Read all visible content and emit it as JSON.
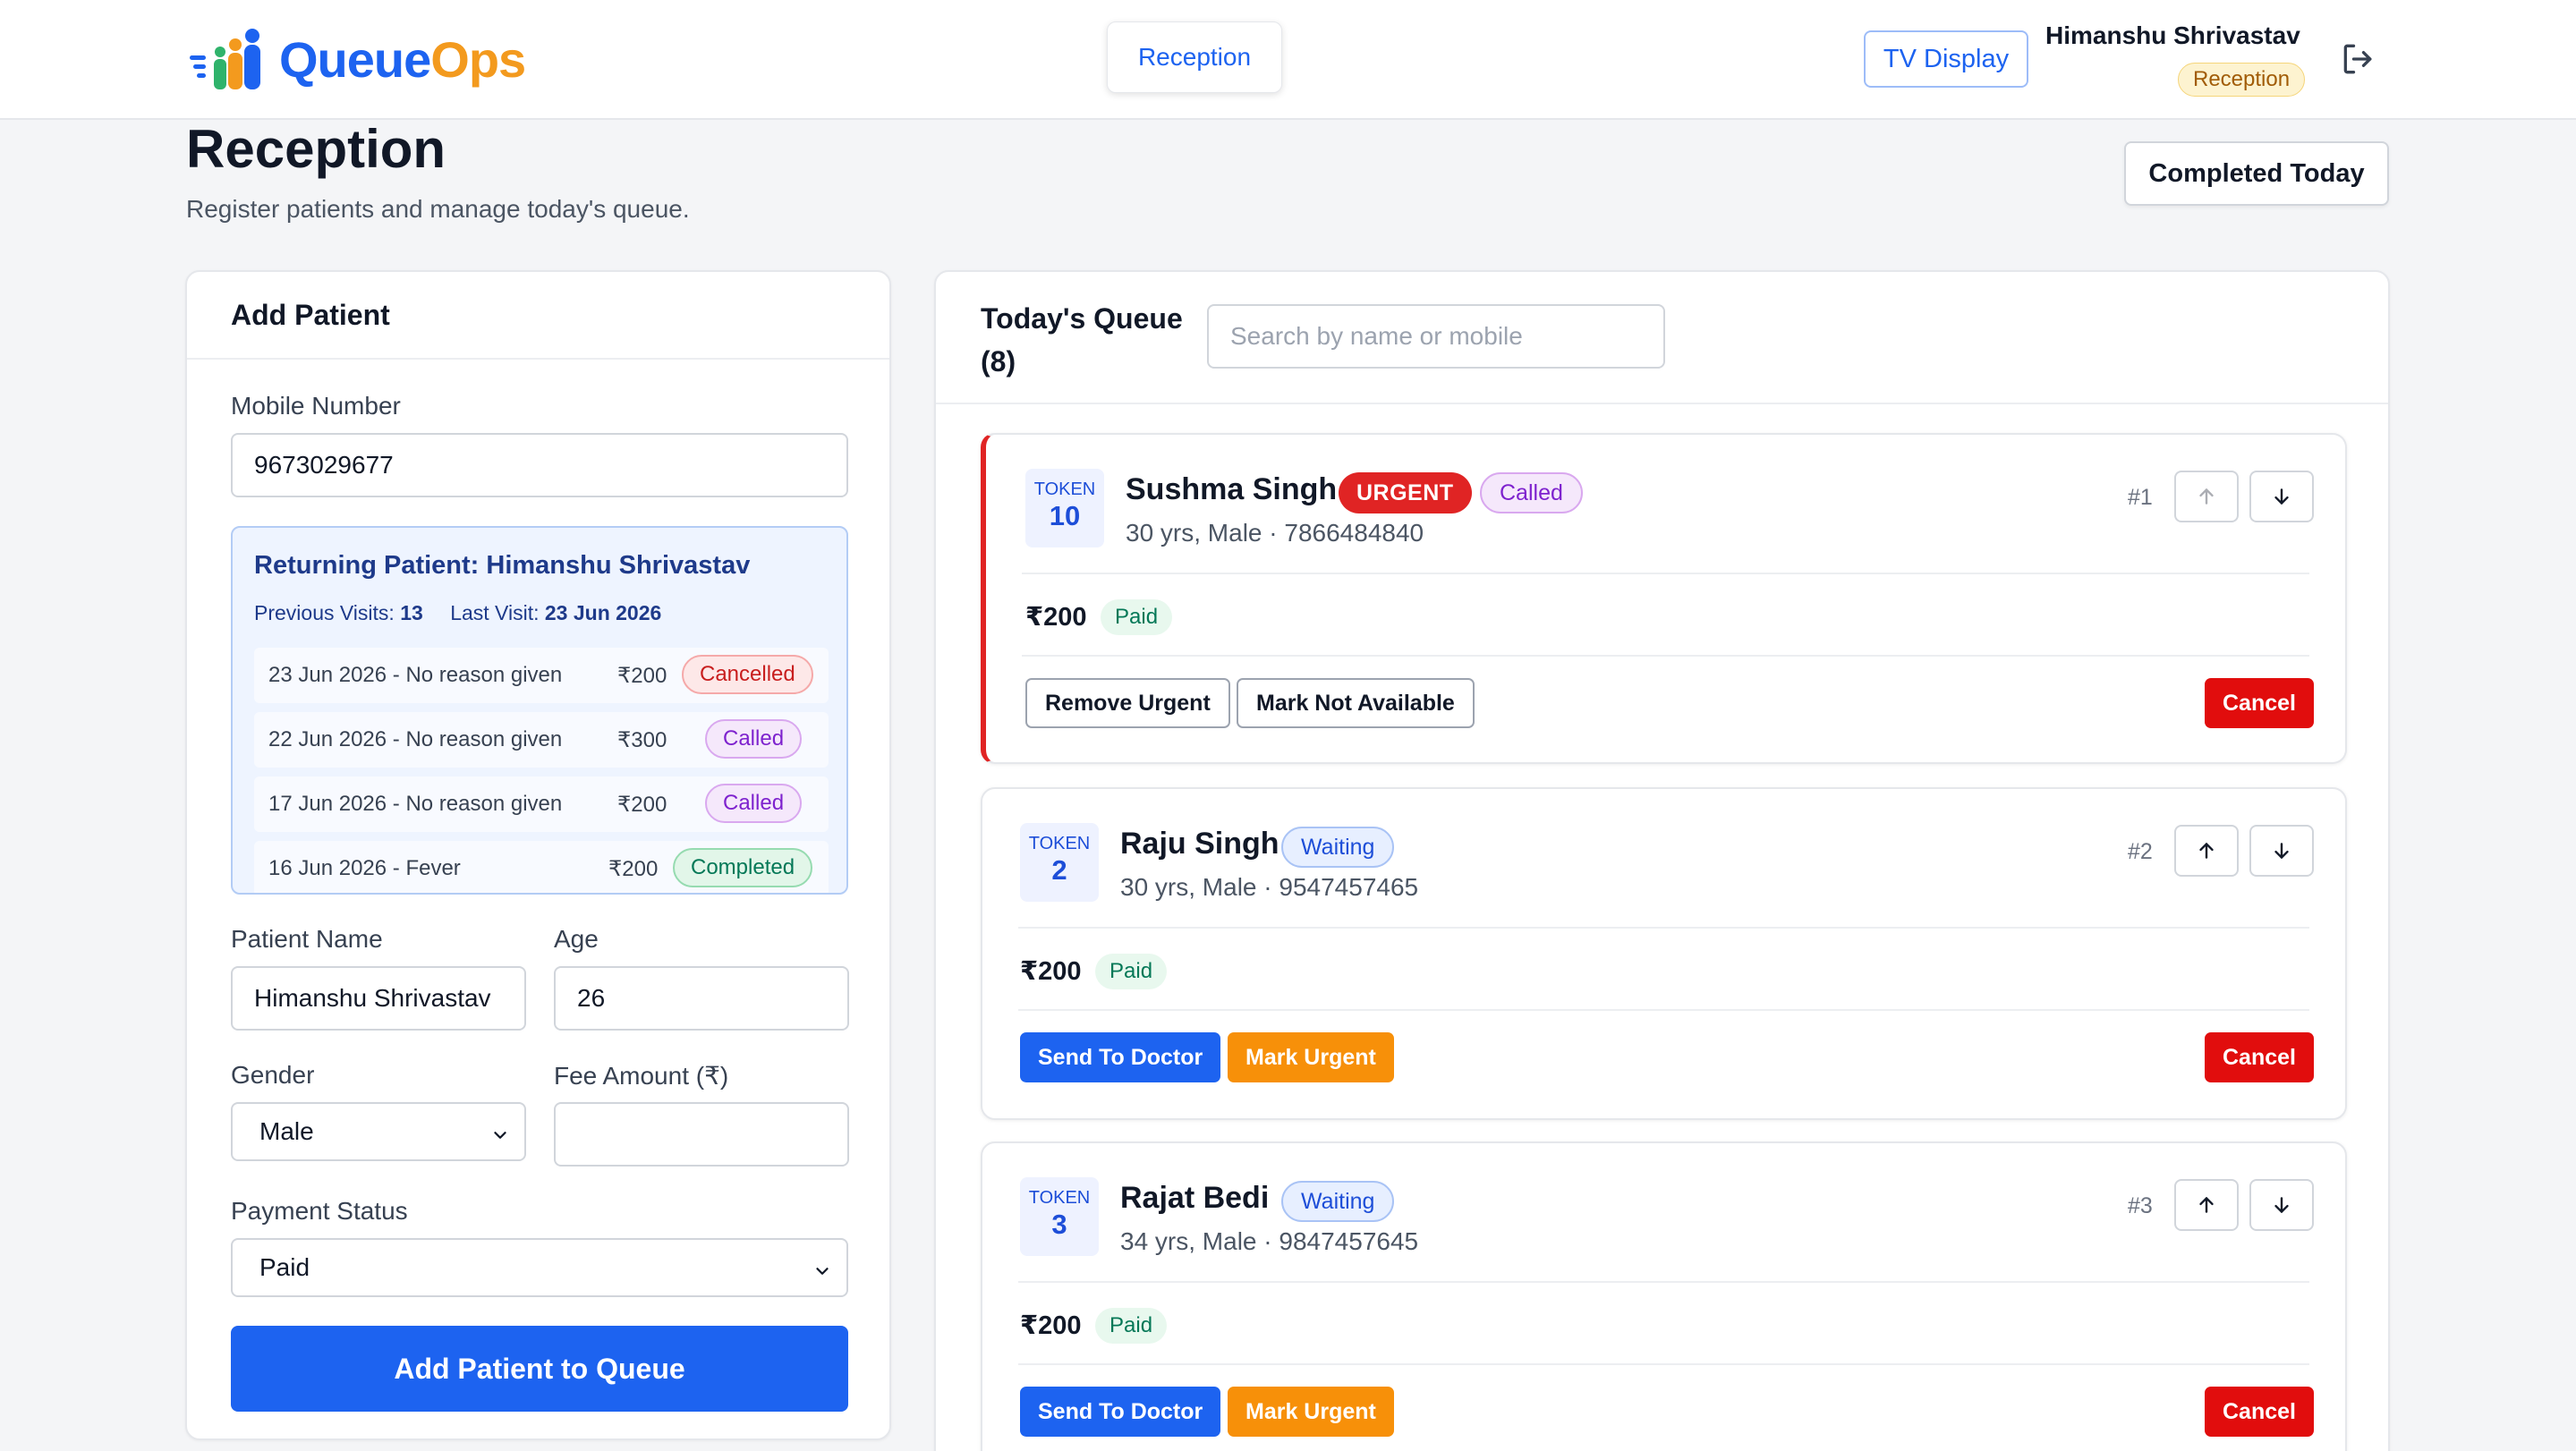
{
  "app": {
    "logo_queue": "Queue",
    "logo_ops": "Ops",
    "nav_tab": "Reception",
    "tv_display": "TV Display",
    "user_name": "Himanshu Shrivastav",
    "user_role": "Reception"
  },
  "page": {
    "title": "Reception",
    "subtitle": "Register patients and manage today's queue.",
    "completed_today": "Completed Today"
  },
  "add_patient": {
    "title": "Add Patient",
    "mobile_label": "Mobile Number",
    "mobile_value": "9673029677",
    "returning": {
      "title": "Returning Patient: Himanshu Shrivastav",
      "prev_visits_label": "Previous Visits:",
      "prev_visits_value": "13",
      "last_visit_label": "Last Visit:",
      "last_visit_value": "23 Jun 2026",
      "visits": [
        {
          "desc": "23 Jun 2026 - No reason given",
          "fee": "₹200",
          "status": "Cancelled"
        },
        {
          "desc": "22 Jun 2026 - No reason given",
          "fee": "₹300",
          "status": "Called"
        },
        {
          "desc": "17 Jun 2026 - No reason given",
          "fee": "₹200",
          "status": "Called"
        },
        {
          "desc": "16 Jun 2026 - Fever",
          "fee": "₹200",
          "status": "Completed"
        }
      ]
    },
    "name_label": "Patient Name",
    "name_value": "Himanshu Shrivastav",
    "age_label": "Age",
    "age_value": "26",
    "gender_label": "Gender",
    "gender_value": "Male",
    "fee_label": "Fee Amount (₹)",
    "fee_value": "",
    "payment_label": "Payment Status",
    "payment_value": "Paid",
    "submit": "Add Patient to Queue"
  },
  "queue": {
    "title": "Today's Queue",
    "count": "(8)",
    "search_placeholder": "Search by name or mobile",
    "token_label": "TOKEN",
    "items": [
      {
        "token": "10",
        "name": "Sushma Singh",
        "urgent": "URGENT",
        "status": "Called",
        "info": "30 yrs, Male · 7866484840",
        "position": "#1",
        "fee": "₹200",
        "payment": "Paid",
        "actions": [
          "Remove Urgent",
          "Mark Not Available"
        ],
        "cancel": "Cancel"
      },
      {
        "token": "2",
        "name": "Raju Singh",
        "status": "Waiting",
        "info": "30 yrs, Male · 9547457465",
        "position": "#2",
        "fee": "₹200",
        "payment": "Paid",
        "actions": [
          "Send To Doctor",
          "Mark Urgent"
        ],
        "cancel": "Cancel"
      },
      {
        "token": "3",
        "name": "Rajat Bedi",
        "status": "Waiting",
        "info": "34 yrs, Male · 9847457645",
        "position": "#3",
        "fee": "₹200",
        "payment": "Paid",
        "actions": [
          "Send To Doctor",
          "Mark Urgent"
        ],
        "cancel": "Cancel"
      }
    ]
  },
  "colors": {
    "primary": "#1d63f0",
    "accent_orange": "#f79009",
    "danger": "#e10d0d"
  },
  "icons": [
    "queueops-logo-icon",
    "logout-icon",
    "chevron-down-icon",
    "arrow-up-icon",
    "arrow-down-icon"
  ]
}
